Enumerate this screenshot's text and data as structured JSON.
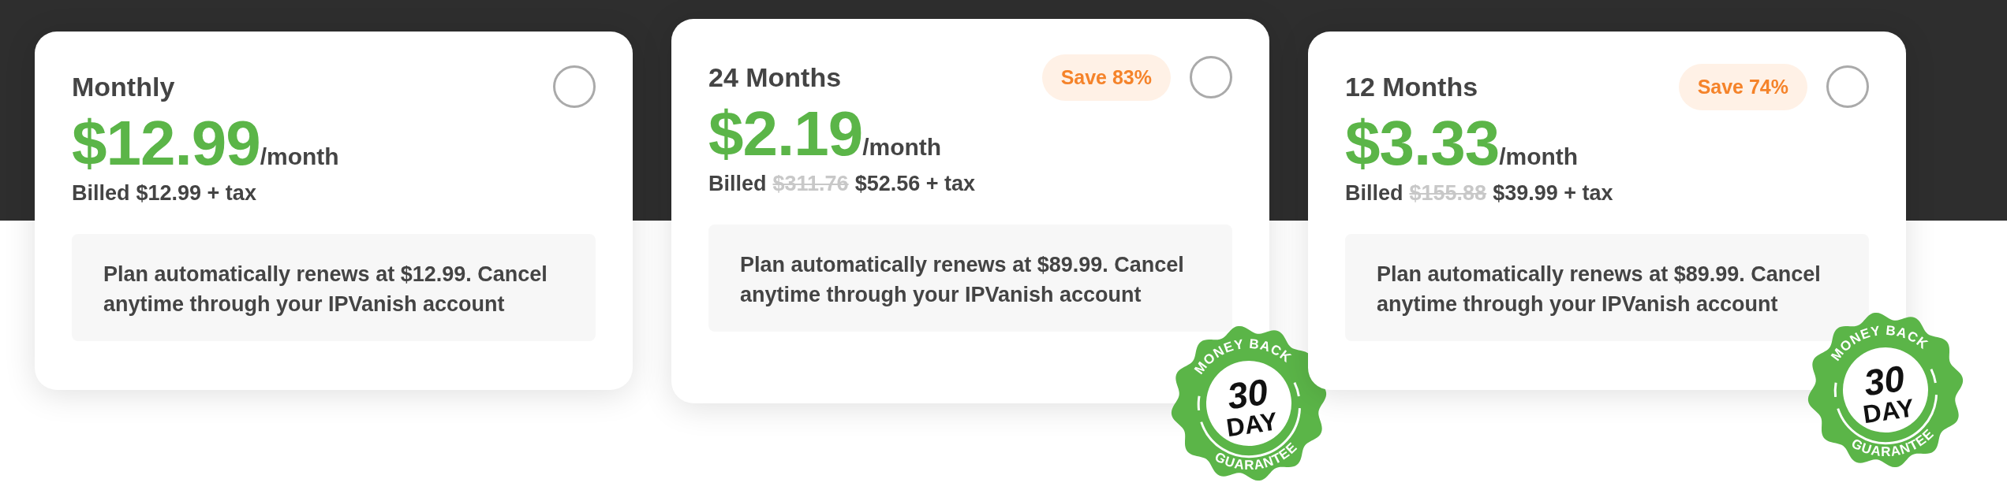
{
  "plans": [
    {
      "title": "Monthly",
      "raised": false,
      "selected": false,
      "price": "$12.99",
      "period": "/month",
      "billed": {
        "label": "Billed",
        "amount": "$12.99 + tax"
      },
      "note": "Plan automatically renews at $12.99. Cancel anytime through your IPVanish account"
    },
    {
      "title": "24 Months",
      "raised": true,
      "selected": false,
      "save": "Save 83%",
      "price": "$2.19",
      "period": "/month",
      "billed": {
        "label": "Billed",
        "original": "$311.76",
        "amount": "$52.56 + tax"
      },
      "note": "Plan automatically renews at $89.99. Cancel anytime through your IPVanish account",
      "badge": {
        "top": "MONEY BACK",
        "number": "30",
        "unit": "DAY",
        "bottom": "GUARANTEE"
      }
    },
    {
      "title": "12 Months",
      "raised": false,
      "selected": false,
      "save": "Save 74%",
      "price": "$3.33",
      "period": "/month",
      "billed": {
        "label": "Billed",
        "original": "$155.88",
        "amount": "$39.99 + tax"
      },
      "note": "Plan automatically renews at $89.99. Cancel anytime through your IPVanish account",
      "badge": {
        "top": "MONEY BACK",
        "number": "30",
        "unit": "DAY",
        "bottom": "GUARANTEE"
      }
    }
  ]
}
